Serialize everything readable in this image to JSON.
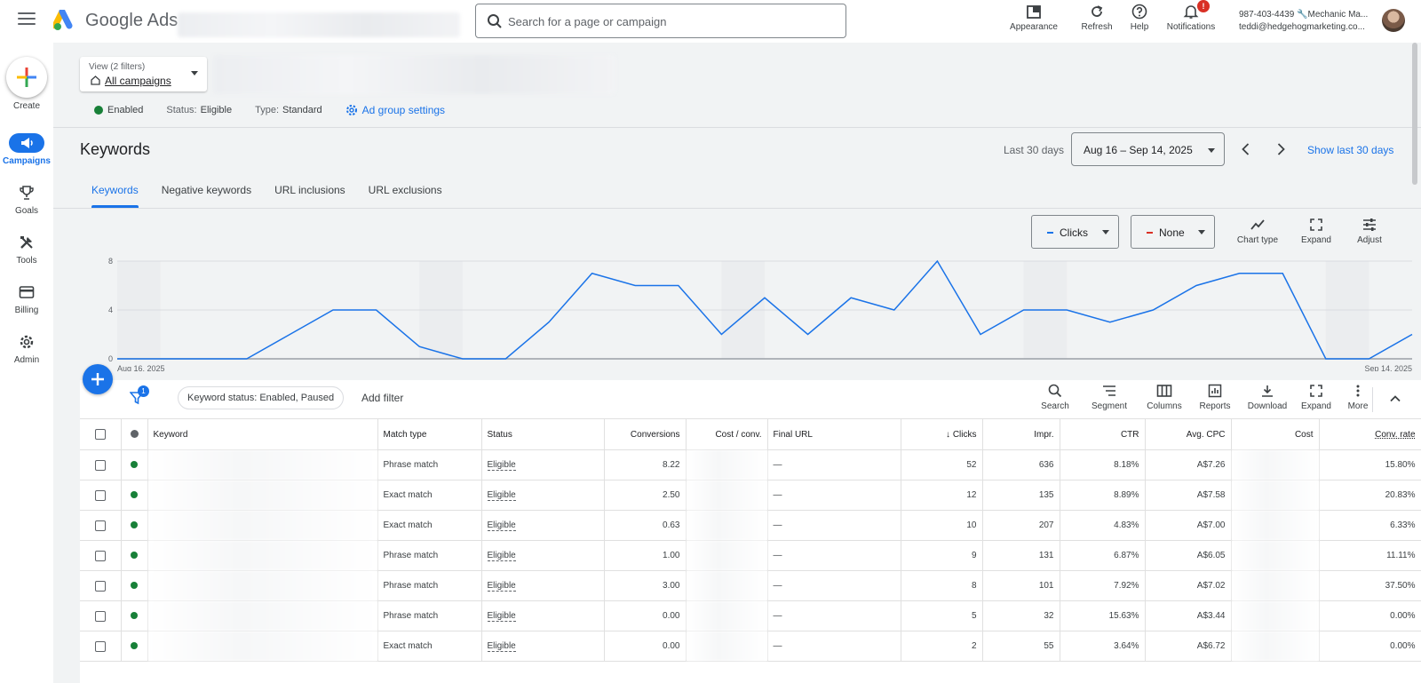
{
  "app": {
    "name": "Google Ads"
  },
  "search": {
    "placeholder": "Search for a page or campaign"
  },
  "top_actions": [
    {
      "label": "Appearance",
      "icon": "appearance-icon"
    },
    {
      "label": "Refresh",
      "icon": "refresh-icon"
    },
    {
      "label": "Help",
      "icon": "help-icon"
    },
    {
      "label": "Notifications",
      "icon": "bell-icon",
      "badge": "!"
    }
  ],
  "account": {
    "line1": "987-403-4439 🔧Mechanic Ma...",
    "line2": "teddi@hedgehogmarketing.co..."
  },
  "nav": {
    "create": "Create",
    "items": [
      {
        "label": "Campaigns",
        "icon": "megaphone-icon",
        "active": true
      },
      {
        "label": "Goals",
        "icon": "trophy-icon"
      },
      {
        "label": "Tools",
        "icon": "tools-icon"
      },
      {
        "label": "Billing",
        "icon": "credit-card-icon"
      },
      {
        "label": "Admin",
        "icon": "gear-icon"
      }
    ]
  },
  "view": {
    "label": "View (2 filters)",
    "value": "All campaigns"
  },
  "status_bar": {
    "enabled": "Enabled",
    "status_label": "Status:",
    "status_value": "Eligible",
    "type_label": "Type:",
    "type_value": "Standard",
    "settings_link": "Ad group settings"
  },
  "page": {
    "title": "Keywords"
  },
  "date_range": {
    "label": "Last 30 days",
    "value": "Aug 16 – Sep 14, 2025",
    "show_last": "Show last 30 days"
  },
  "tabs": [
    "Keywords",
    "Negative keywords",
    "URL inclusions",
    "URL exclusions"
  ],
  "chart_controls": {
    "metric1": "Clicks",
    "metric2": "None",
    "tools": [
      {
        "label": "Chart type",
        "icon": "chart-type-icon"
      },
      {
        "label": "Expand",
        "icon": "expand-icon"
      },
      {
        "label": "Adjust",
        "icon": "adjust-icon"
      }
    ]
  },
  "colors": {
    "accent": "#1a73e8",
    "series": "#1a73e8",
    "none_swatch": "#d93025",
    "enabled": "#188038"
  },
  "chart_data": {
    "type": "line",
    "x_start_label": "Aug 16, 2025",
    "x_end_label": "Sep 14, 2025",
    "y_ticks": [
      "0",
      "4",
      "8"
    ],
    "ylim": [
      0,
      8
    ],
    "grid": true,
    "series": [
      {
        "name": "Clicks",
        "values": [
          0,
          0,
          0,
          0,
          2,
          4,
          4,
          1,
          0,
          0,
          3,
          7,
          6,
          6,
          2,
          5,
          2,
          5,
          4,
          8,
          2,
          4,
          4,
          3,
          4,
          6,
          7,
          7,
          0,
          0,
          2
        ]
      }
    ]
  },
  "table_toolbar": {
    "filter_badge": "1",
    "chip": "Keyword status: Enabled, Paused",
    "add_filter": "Add filter",
    "tools": [
      {
        "label": "Search",
        "icon": "search-icon"
      },
      {
        "label": "Segment",
        "icon": "segment-icon"
      },
      {
        "label": "Columns",
        "icon": "columns-icon"
      },
      {
        "label": "Reports",
        "icon": "reports-icon"
      },
      {
        "label": "Download",
        "icon": "download-icon"
      },
      {
        "label": "Expand",
        "icon": "expand-icon"
      },
      {
        "label": "More",
        "icon": "more-vert-icon"
      }
    ]
  },
  "table": {
    "headers": [
      "Keyword",
      "Match type",
      "Status",
      "Conversions",
      "Cost / conv.",
      "Final URL",
      "Clicks",
      "Impr.",
      "CTR",
      "Avg. CPC",
      "Cost",
      "Conv. rate"
    ],
    "rows": [
      {
        "match": "Phrase match",
        "status": "Eligible",
        "conversions": "8.22",
        "final_url": "—",
        "clicks": "52",
        "impr": "636",
        "ctr": "8.18%",
        "cpc": "A$7.26",
        "conv_rate": "15.80%"
      },
      {
        "match": "Exact match",
        "status": "Eligible",
        "conversions": "2.50",
        "final_url": "—",
        "clicks": "12",
        "impr": "135",
        "ctr": "8.89%",
        "cpc": "A$7.58",
        "conv_rate": "20.83%"
      },
      {
        "match": "Exact match",
        "status": "Eligible",
        "conversions": "0.63",
        "final_url": "—",
        "clicks": "10",
        "impr": "207",
        "ctr": "4.83%",
        "cpc": "A$7.00",
        "conv_rate": "6.33%"
      },
      {
        "match": "Phrase match",
        "status": "Eligible",
        "conversions": "1.00",
        "final_url": "—",
        "clicks": "9",
        "impr": "131",
        "ctr": "6.87%",
        "cpc": "A$6.05",
        "conv_rate": "11.11%"
      },
      {
        "match": "Phrase match",
        "status": "Eligible",
        "conversions": "3.00",
        "final_url": "—",
        "clicks": "8",
        "impr": "101",
        "ctr": "7.92%",
        "cpc": "A$7.02",
        "conv_rate": "37.50%"
      },
      {
        "match": "Phrase match",
        "status": "Eligible",
        "conversions": "0.00",
        "final_url": "—",
        "clicks": "5",
        "impr": "32",
        "ctr": "15.63%",
        "cpc": "A$3.44",
        "conv_rate": "0.00%"
      },
      {
        "match": "Exact match",
        "status": "Eligible",
        "conversions": "0.00",
        "final_url": "—",
        "clicks": "2",
        "impr": "55",
        "ctr": "3.64%",
        "cpc": "A$6.72",
        "conv_rate": "0.00%"
      }
    ]
  }
}
